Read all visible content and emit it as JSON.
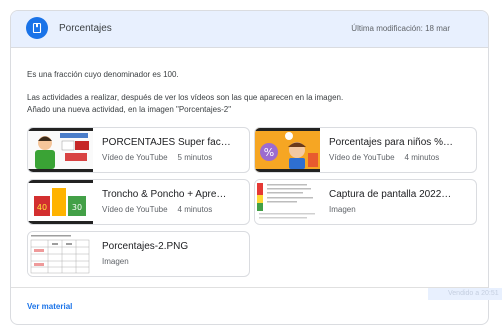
{
  "header": {
    "title": "Porcentajes",
    "modified": "Última modificación: 18 mar"
  },
  "description": {
    "line1": "Es una fracción cuyo denominador es 100.",
    "line2": "Las actividades a realizar, después de ver los vídeos son las que aparecen en la imagen.",
    "line3": "Añado una nueva actividad, en la imagen \"Porcentajes-2\""
  },
  "attachments": [
    {
      "title": "PORCENTAJES Super fac…",
      "type": "Vídeo de YouTube",
      "duration": "5 minutos",
      "thumb_icon": "video-thumbnail-porcentajes"
    },
    {
      "title": "Porcentajes para niños %…",
      "type": "Vídeo de YouTube",
      "duration": "4 minutos",
      "thumb_icon": "video-thumbnail-ninos"
    },
    {
      "title": "Troncho & Poncho + Apre…",
      "type": "Vídeo de YouTube",
      "duration": "4 minutos",
      "thumb_icon": "video-thumbnail-troncho"
    },
    {
      "title": "Captura de pantalla 2022…",
      "type": "Imagen",
      "duration": "",
      "thumb_icon": "image-thumbnail-captura"
    },
    {
      "title": "Porcentajes-2.PNG",
      "type": "Imagen",
      "duration": "",
      "thumb_icon": "image-thumbnail-table"
    }
  ],
  "footer": {
    "view_label": "Ver material"
  },
  "ghost": {
    "label": "Vendido a 20:51"
  },
  "colors": {
    "accent": "#1a73e8",
    "header_bg": "#e8f0fe"
  }
}
